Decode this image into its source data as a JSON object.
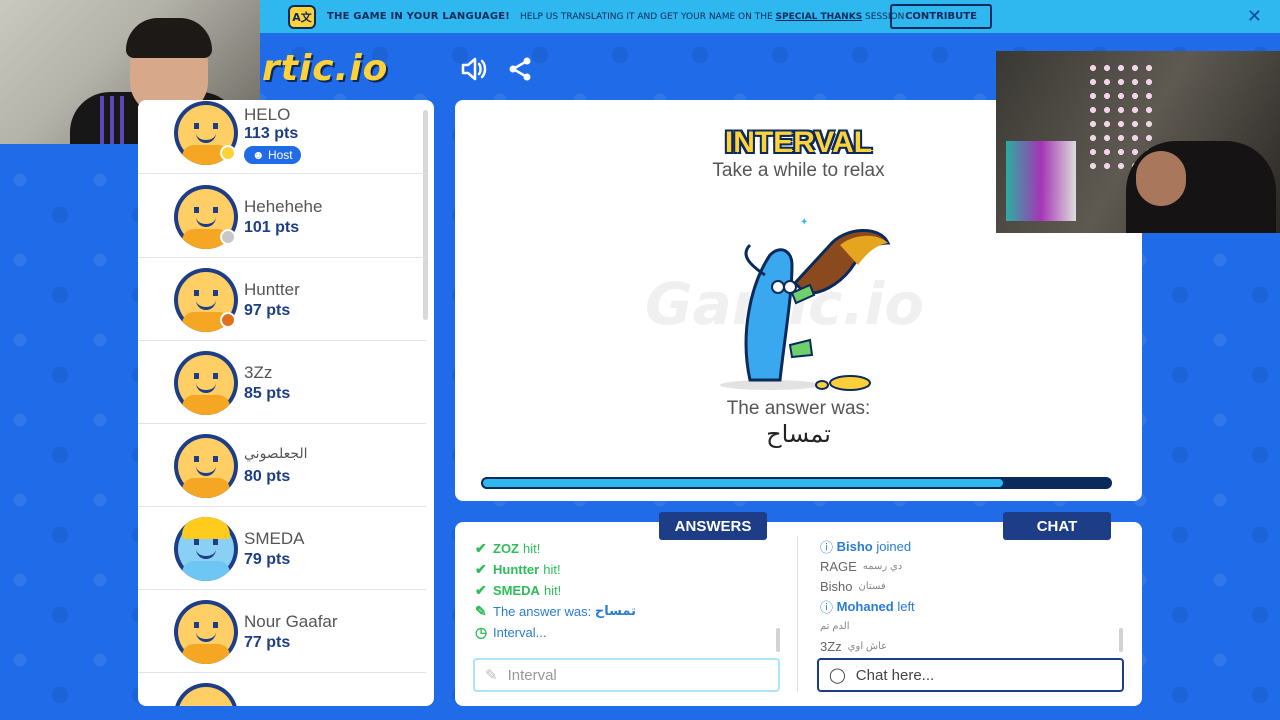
{
  "banner": {
    "translate_icon": "translate-icon",
    "title": "THE GAME IN YOUR LANGUAGE!",
    "text_before": "HELP US TRANSLATING IT AND GET YOUR NAME ON THE",
    "link": "SPECIAL THANKS",
    "text_after": "SESSION",
    "contribute": "CONTRIBUTE",
    "close": "✕"
  },
  "header": {
    "logo": "rtic.io",
    "sound_icon": "speaker-icon",
    "share_icon": "share-icon"
  },
  "players": [
    {
      "name": "HELO",
      "pts": "113 pts",
      "host": "Host",
      "status": "#ffd23a"
    },
    {
      "name": "Hehehehe",
      "pts": "101 pts",
      "status": "#c8c8c8"
    },
    {
      "name": "Huntter",
      "pts": "97 pts",
      "status": "#e0701c"
    },
    {
      "name": "3Zz",
      "pts": "85 pts"
    },
    {
      "name": "الجعلصوني",
      "pts": "80 pts"
    },
    {
      "name": "SMEDA",
      "pts": "79 pts"
    },
    {
      "name": "Nour Gaafar",
      "pts": "77 pts"
    }
  ],
  "game": {
    "title": "INTERVAL",
    "subtitle": "Take a while to relax",
    "watermark": "Gartic.io",
    "answer_label": "The answer was:",
    "answer": "تمساح",
    "progress": 0.83
  },
  "answers": {
    "header": "ANSWERS",
    "rows": [
      {
        "name": "ZOZ",
        "word": "hit!"
      },
      {
        "name": "Huntter",
        "word": "hit!"
      },
      {
        "name": "SMEDA",
        "word": "hit!"
      }
    ],
    "answer_text": "The answer was:",
    "answer_word": "تمساح",
    "interval_text": "Interval...",
    "input_placeholder": "Interval"
  },
  "chat": {
    "header": "CHAT",
    "rows": [
      {
        "type": "info",
        "name": "Bisho",
        "text": "joined"
      },
      {
        "type": "msg",
        "name": "RAGE",
        "text": "دي رسمه"
      },
      {
        "type": "msg",
        "name": "Bisho",
        "text": "فستان"
      },
      {
        "type": "info",
        "name": "Mohaned",
        "text": "left"
      },
      {
        "type": "msg",
        "name": "",
        "text": "الدم تم"
      },
      {
        "type": "msg",
        "name": "3Zz",
        "text": "عاش اوي"
      }
    ],
    "input_placeholder": "Chat here..."
  },
  "colors": {
    "background": "#1f6be8",
    "banner": "#2fb8f0",
    "navy": "#1d3e86",
    "hit_green": "#2ebd59",
    "accent_yellow": "#ffd23a"
  }
}
